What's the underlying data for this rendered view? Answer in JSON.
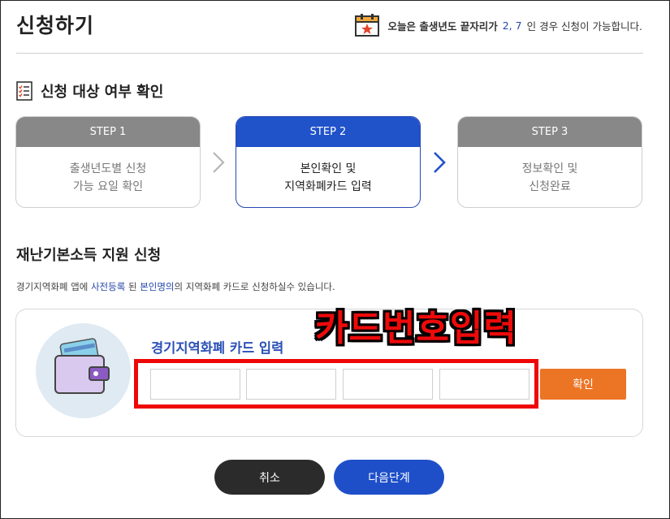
{
  "header": {
    "title": "신청하기",
    "notice_prefix": "오늘은 출생년도 끝자리가",
    "notice_numbers": "2, 7",
    "notice_suffix": "인 경우 신청이 가능합니다."
  },
  "eligibility": {
    "title": "신청 대상 여부 확인",
    "steps": [
      {
        "label": "STEP 1",
        "line1": "출생년도별 신청",
        "line2": "가능 요일 확인",
        "active": false
      },
      {
        "label": "STEP 2",
        "line1": "본인확인 및",
        "line2": "지역화폐카드 입력",
        "active": true
      },
      {
        "label": "STEP 3",
        "line1": "정보확인 및",
        "line2": "신청완료",
        "active": false
      }
    ]
  },
  "application": {
    "title": "재난기본소득 지원 신청",
    "desc_part1": "경기지역화폐 앱에",
    "desc_link1": "사전등록",
    "desc_part2": "된",
    "desc_link2": "본인명의",
    "desc_part3": "의 지역화폐 카드로 신청하실수 있습니다.",
    "card_label": "경기지역화폐 카드 입력",
    "card_inputs": [
      "",
      "",
      "",
      ""
    ],
    "confirm_label": "확인",
    "overlay_text": "카드번호입력"
  },
  "footer": {
    "cancel_label": "취소",
    "next_label": "다음단계"
  },
  "colors": {
    "accent_blue": "#2052c9",
    "orange": "#ec7425",
    "highlight_red": "#ee0707"
  }
}
